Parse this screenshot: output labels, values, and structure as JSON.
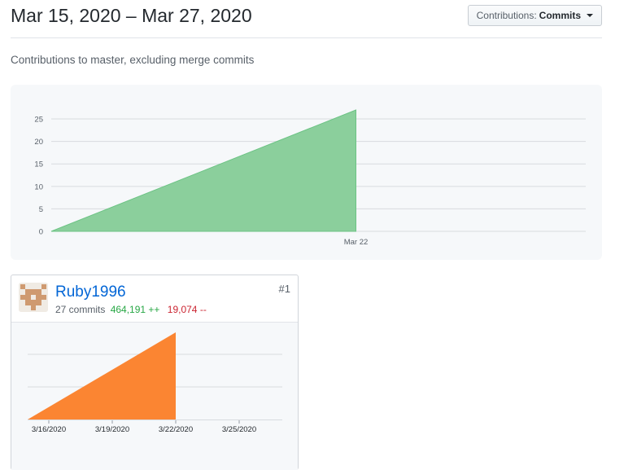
{
  "header": {
    "range_title": "Mar 15, 2020 – Mar 27, 2020",
    "dropdown_prefix": "Contributions:",
    "dropdown_value": "Commits"
  },
  "subtitle": "Contributions to master, excluding merge commits",
  "colors": {
    "main_area": "#8bcf9c",
    "main_area_edge": "#6cc384",
    "contributor_area": "#fb8532",
    "link": "#0366d6",
    "additions": "#28a745",
    "deletions": "#cb2431"
  },
  "contributor": {
    "rank": "#1",
    "username": "Ruby1996",
    "commits": "27 commits",
    "additions": "464,191 ++",
    "deletions": "19,074 --",
    "avatar_icon": "identicon-icon"
  },
  "chart_data": [
    {
      "type": "area",
      "x": [
        "2020-03-15",
        "2020-03-22"
      ],
      "y": [
        0,
        27
      ],
      "x_ticks": [
        "Mar 22"
      ],
      "y_ticks": [
        "0",
        "5",
        "10",
        "15",
        "20",
        "25"
      ],
      "ylim": [
        0,
        27
      ],
      "grid": true,
      "legend": "none"
    },
    {
      "type": "area",
      "x": [
        "2020-03-15",
        "2020-03-22"
      ],
      "y": [
        0,
        27
      ],
      "x_ticks": [
        "3/16/2020",
        "3/19/2020",
        "3/22/2020",
        "3/25/2020"
      ],
      "ylim": [
        0,
        27
      ],
      "grid": true,
      "legend": "none"
    }
  ]
}
